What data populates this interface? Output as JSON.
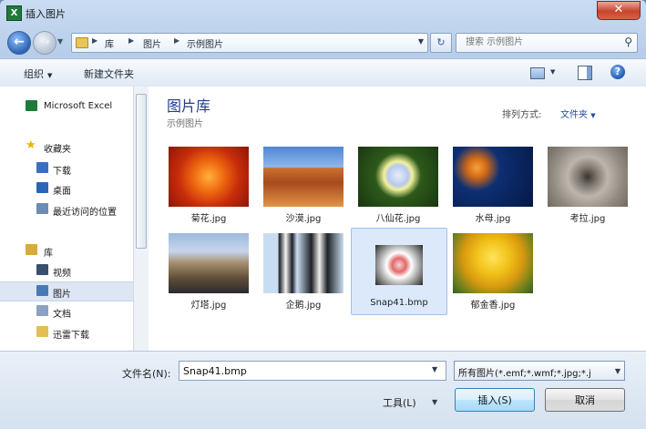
{
  "window": {
    "title": "插入图片",
    "app_icon_text": "X",
    "close_label": "✕"
  },
  "nav": {
    "breadcrumbs": [
      "库",
      "图片",
      "示例图片"
    ],
    "search_placeholder": "搜索 示例图片"
  },
  "toolbar": {
    "organize": "组织",
    "new_folder": "新建文件夹"
  },
  "sidebar": {
    "items": [
      {
        "label": "Microsoft Excel",
        "icon": "excel-icon",
        "color": "#1f7a3a"
      },
      {
        "label": "收藏夹",
        "icon": "star-icon",
        "color": "#e8b400"
      },
      {
        "label": "下载",
        "icon": "download-folder-icon",
        "color": "#3c6fbf"
      },
      {
        "label": "桌面",
        "icon": "desktop-icon",
        "color": "#2d65b5"
      },
      {
        "label": "最近访问的位置",
        "icon": "recent-places-icon",
        "color": "#6d8cb3"
      },
      {
        "label": "库",
        "icon": "library-icon",
        "color": "#d9aa3c"
      },
      {
        "label": "视频",
        "icon": "video-library-icon",
        "color": "#3a4f6e"
      },
      {
        "label": "图片",
        "icon": "pictures-library-icon",
        "color": "#4b79b6"
      },
      {
        "label": "文档",
        "icon": "documents-library-icon",
        "color": "#8aa2c4"
      },
      {
        "label": "迅雷下载",
        "icon": "folder-icon",
        "color": "#e3bd55"
      }
    ]
  },
  "library": {
    "title": "图片库",
    "subtitle": "示例图片",
    "arrange_label": "排列方式:",
    "arrange_value": "文件夹"
  },
  "files": [
    {
      "name": "菊花.jpg",
      "thumb": "chrysanthemum",
      "selected": false
    },
    {
      "name": "沙漠.jpg",
      "thumb": "desert",
      "selected": false
    },
    {
      "name": "八仙花.jpg",
      "thumb": "hydrangeas",
      "selected": false
    },
    {
      "name": "水母.jpg",
      "thumb": "jellyfish",
      "selected": false
    },
    {
      "name": "考拉.jpg",
      "thumb": "koala",
      "selected": false
    },
    {
      "name": "灯塔.jpg",
      "thumb": "lighthouse",
      "selected": false
    },
    {
      "name": "企鹅.jpg",
      "thumb": "penguins",
      "selected": false
    },
    {
      "name": "Snap41.bmp",
      "thumb": "snap",
      "selected": true
    },
    {
      "name": "郁金香.jpg",
      "thumb": "tulips",
      "selected": false
    }
  ],
  "footer": {
    "filename_label": "文件名(N):",
    "filename_value": "Snap41.bmp",
    "filter_value": "所有图片(*.emf;*.wmf;*.jpg;*.j",
    "tools_label": "工具(L)",
    "insert_label": "插入(S)",
    "cancel_label": "取消"
  }
}
